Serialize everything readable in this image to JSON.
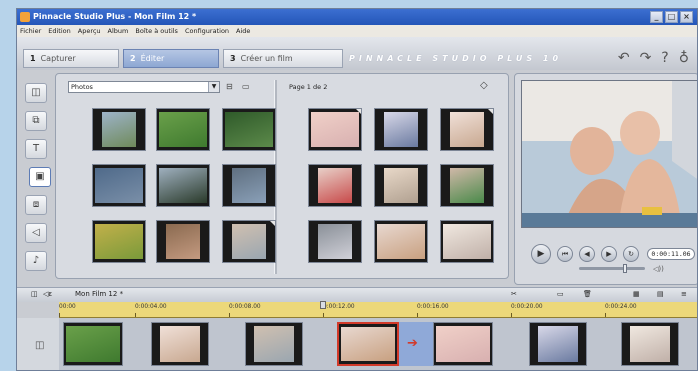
{
  "window": {
    "title": "Pinnacle Studio Plus - Mon Film 12 *",
    "buttons": [
      "_",
      "□",
      "×"
    ]
  },
  "menu": [
    "Fichier",
    "Edition",
    "Aperçu",
    "Album",
    "Boîte à outils",
    "Configuration",
    "Aide"
  ],
  "tabs": [
    {
      "num": "1",
      "label": "Capturer",
      "active": false
    },
    {
      "num": "2",
      "label": "Éditer",
      "active": true
    },
    {
      "num": "3",
      "label": "Créer un film",
      "active": false
    }
  ],
  "brand": "PINNACLE STUDIO PLUS 10",
  "top_icons": [
    "undo-icon",
    "redo-icon",
    "help-icon",
    "bulb-icon"
  ],
  "left_tools": [
    {
      "name": "video-tab-icon",
      "glyph": "◫"
    },
    {
      "name": "transitions-tab-icon",
      "glyph": "⧉"
    },
    {
      "name": "titles-tab-icon",
      "glyph": "T"
    },
    {
      "name": "photos-tab-icon",
      "glyph": "▣"
    },
    {
      "name": "menus-tab-icon",
      "glyph": "⧈"
    },
    {
      "name": "sound-effects-tab-icon",
      "glyph": "◁"
    },
    {
      "name": "music-tab-icon",
      "glyph": "♪"
    }
  ],
  "album": {
    "dropdown": "Photos",
    "page_info": "Page 1 de 2",
    "left_thumbs": [
      {
        "colors": [
          "#6f8a5a",
          "#9db3c9"
        ],
        "style": "narrow"
      },
      {
        "colors": [
          "#3f7a2f",
          "#6aa04a"
        ],
        "style": "full"
      },
      {
        "colors": [
          "#5c8a4a",
          "#2f5a2a"
        ],
        "style": "full"
      },
      {
        "colors": [
          "#7a8fa8",
          "#4f6a8a"
        ],
        "style": "full"
      },
      {
        "colors": [
          "#2a3a2a",
          "#9fb0bf"
        ],
        "style": "full"
      },
      {
        "colors": [
          "#8aa0b8",
          "#5f6f80"
        ],
        "style": "narrow"
      },
      {
        "colors": [
          "#7a9a3a",
          "#c2b04a"
        ],
        "style": "full"
      },
      {
        "colors": [
          "#c49a80",
          "#8a6a50"
        ],
        "style": "narrow"
      },
      {
        "colors": [
          "#9aa6b0",
          "#d0c0b0"
        ],
        "style": "narrow"
      }
    ],
    "right_thumbs": [
      {
        "colors": [
          "#d8b0b0",
          "#f0d0c8"
        ],
        "style": "full"
      },
      {
        "colors": [
          "#6a7aa0",
          "#d8d8e8"
        ],
        "style": "narrow"
      },
      {
        "colors": [
          "#c8a890",
          "#f0e0d8"
        ],
        "style": "narrow"
      },
      {
        "colors": [
          "#c84a4a",
          "#e8d0c8"
        ],
        "style": "narrow"
      },
      {
        "colors": [
          "#b0a090",
          "#e8d8c8"
        ],
        "style": "narrow"
      },
      {
        "colors": [
          "#4a8a4a",
          "#d0b8a8"
        ],
        "style": "narrow"
      },
      {
        "colors": [
          "#d0d0d8",
          "#8a9098"
        ],
        "style": "narrow"
      },
      {
        "colors": [
          "#c8a080",
          "#e8d8d0"
        ],
        "style": "full"
      },
      {
        "colors": [
          "#c0b0a8",
          "#f0e8e0"
        ],
        "style": "full"
      }
    ]
  },
  "preview": {
    "timecode": "0:00:11.06",
    "controls": [
      {
        "name": "play-button",
        "glyph": "▶"
      },
      {
        "name": "rewind-button",
        "glyph": "⏮"
      },
      {
        "name": "step-back-button",
        "glyph": "◀◀"
      },
      {
        "name": "step-forward-button",
        "glyph": "▶▶"
      },
      {
        "name": "loop-button",
        "glyph": "↻"
      }
    ],
    "scrub_position": 0.67
  },
  "timeline": {
    "project_title": "Mon Film 12 *",
    "ticks": [
      "00:00",
      "0:00:04.00",
      "0:00:08.00",
      "0:00:12.00",
      "0:00:16.00",
      "0:00:20.00",
      "0:00:24.00"
    ],
    "clips": [
      {
        "colors": [
          "#3f7a2f",
          "#6aa04a"
        ],
        "style": "full",
        "selected": false
      },
      {
        "colors": [
          "#c8a890",
          "#f0e0d8"
        ],
        "style": "narrow",
        "selected": false
      },
      {
        "colors": [
          "#9aa6b0",
          "#d0c0b0"
        ],
        "style": "narrow",
        "selected": false
      },
      {
        "colors": [
          "#c8a080",
          "#e8d8d0"
        ],
        "style": "full",
        "selected": true
      },
      {
        "colors": [
          "#d8b0b0",
          "#f0d0c8"
        ],
        "style": "full",
        "selected": false
      },
      {
        "colors": [
          "#6a7aa0",
          "#d8d8e8"
        ],
        "style": "narrow",
        "selected": false
      },
      {
        "colors": [
          "#c0b0a8",
          "#f0e8e0"
        ],
        "style": "narrow",
        "selected": false
      }
    ]
  }
}
